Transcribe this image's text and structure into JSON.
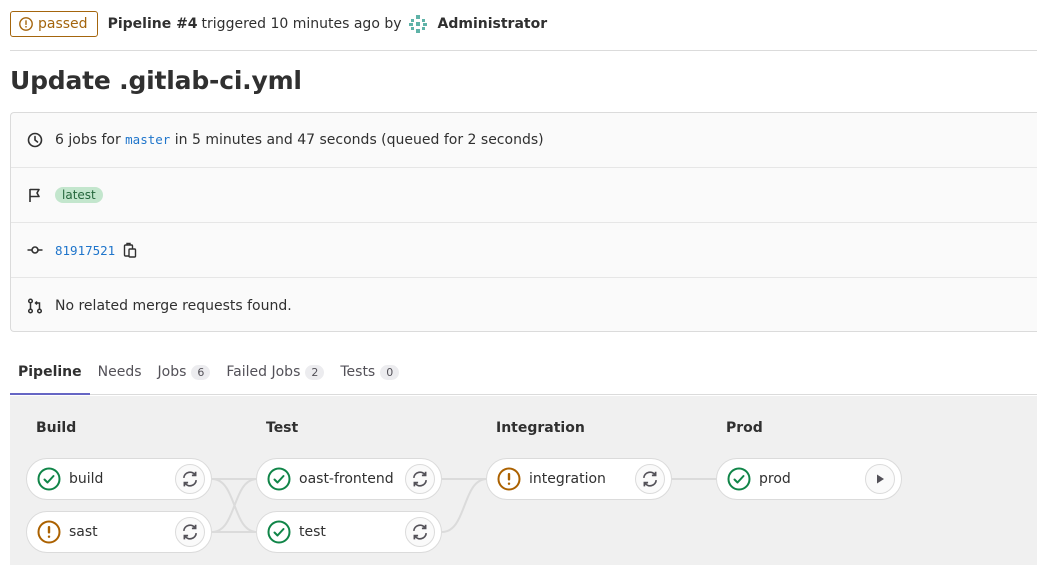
{
  "header": {
    "status": "passed",
    "pipeline": "Pipeline #4",
    "triggered": "triggered 10 minutes ago by",
    "user": "Administrator"
  },
  "title": "Update .gitlab-ci.yml",
  "info": {
    "jobs_prefix": "6 jobs for",
    "branch": "master",
    "duration": "in 5 minutes and 47 seconds (queued for 2 seconds)",
    "tag": "latest",
    "commit": "81917521",
    "merge_requests": "No related merge requests found."
  },
  "tabs": [
    {
      "label": "Pipeline",
      "count": null
    },
    {
      "label": "Needs",
      "count": null
    },
    {
      "label": "Jobs",
      "count": "6"
    },
    {
      "label": "Failed Jobs",
      "count": "2"
    },
    {
      "label": "Tests",
      "count": "0"
    }
  ],
  "stages": [
    {
      "title": "Build",
      "jobs": [
        {
          "name": "build",
          "status": "success",
          "action": "retry"
        },
        {
          "name": "sast",
          "status": "warning",
          "action": "retry"
        }
      ]
    },
    {
      "title": "Test",
      "jobs": [
        {
          "name": "oast-frontend",
          "status": "success",
          "action": "retry"
        },
        {
          "name": "test",
          "status": "success",
          "action": "retry"
        }
      ]
    },
    {
      "title": "Integration",
      "jobs": [
        {
          "name": "integration",
          "status": "warning",
          "action": "retry"
        }
      ]
    },
    {
      "title": "Prod",
      "jobs": [
        {
          "name": "prod",
          "status": "success",
          "action": "play"
        }
      ]
    }
  ],
  "colors": {
    "success": "#108548",
    "warning": "#ab6100",
    "accent": "#6666c4",
    "link": "#1f75cb"
  }
}
